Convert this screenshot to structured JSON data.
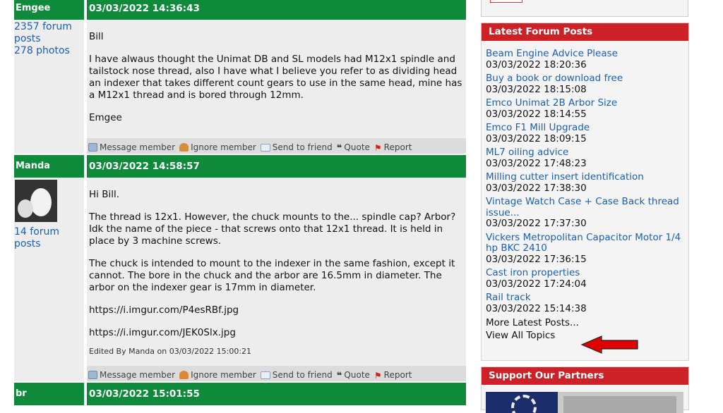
{
  "posts": [
    {
      "author": "Emgee",
      "date": "03/03/2022 14:36:43",
      "author_stats": [
        "2357 forum posts",
        "278 photos"
      ],
      "paragraphs": [
        "Bill",
        "I have alwaus thought the Unimat DB and SL models had M12x1 spindle and tailstock nose thread, also I have what I believe you refer to as dividing head an indexer that takes different count gears to use in the same head, mine has a M12x1 thread and is bored through 12mm.",
        "Emgee"
      ]
    },
    {
      "author": "Manda",
      "date": "03/03/2022 14:58:57",
      "author_stats": [
        "14 forum posts"
      ],
      "paragraphs": [
        "Hi Bill.",
        "The thread is 12x1. However, the chuck mounts to the... spindle cap? Arbor? Idk the name of the piece - that screws onto that 12x1 thread. It is held in place by 3 machine screws.",
        "The chuck is intended to mount to the indexer in the same fashion, except it cannot. The bore in the chuck and the arbor are 16.5mm in diameter. The arbor on the indexer gear is 17mm in diameter.",
        "https://i.imgur.com/P4esRBf.jpg",
        "https://i.imgur.com/JEK0Slx.jpg"
      ],
      "edited": "Edited By Manda on 03/03/2022 15:00:21"
    },
    {
      "author": "br",
      "date": "03/03/2022 15:01:55"
    }
  ],
  "actions": {
    "message": "Message member",
    "ignore": "Ignore member",
    "send": "Send to friend",
    "quote": "Quote",
    "report": "Report"
  },
  "sidebar": {
    "latest_title": "Latest Forum Posts",
    "latest": [
      {
        "title": "Beam Engine Advice Please",
        "time": "03/03/2022 18:20:36"
      },
      {
        "title": "Buy a book or download free",
        "time": "03/03/2022 18:15:08"
      },
      {
        "title": "Emco Unimat 2B Arbor Size",
        "time": "03/03/2022 18:14:55"
      },
      {
        "title": "Emco F1 Mill Upgrade",
        "time": "03/03/2022 18:09:15"
      },
      {
        "title": "ML7 oiling advice",
        "time": "03/03/2022 17:48:23"
      },
      {
        "title": "Milling cutter insert identification",
        "time": "03/03/2022 17:38:30"
      },
      {
        "title": "Vintage Watch Case + Case Back thread issue...",
        "time": "03/03/2022 17:37:30"
      },
      {
        "title": "Vickers Metropolitan Capacitor Motor 1/4 hp BKC 2410",
        "time": "03/03/2022 17:36:15"
      },
      {
        "title": "Cast iron properties",
        "time": "03/03/2022 17:24:04"
      },
      {
        "title": "Rail track",
        "time": "03/03/2022 15:14:38"
      }
    ],
    "more_label": "More Latest Posts...",
    "view_all_label": "View All Topics",
    "partners_title": "Support Our Partners"
  },
  "colors": {
    "post_header_green": "#0f8a3b",
    "sidebar_header_red": "#cc2127",
    "link_blue": "#1a5fb4",
    "arrow_red": "#e00000"
  }
}
